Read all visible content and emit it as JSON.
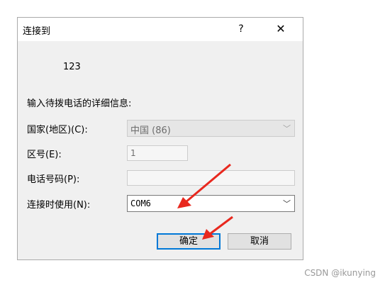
{
  "dialog": {
    "title": "连接到",
    "help_glyph": "?",
    "close_glyph": "✕",
    "connection_name": "123",
    "instruction": "输入待拨电话的详细信息:",
    "country_label": "国家(地区)(C):",
    "country_value": "中国 (86)",
    "area_label": "区号(E):",
    "area_value": "1",
    "phone_label": "电话号码(P):",
    "phone_value": "",
    "connect_label": "连接时使用(N):",
    "connect_value": "COM6",
    "ok_label": "确定",
    "cancel_label": "取消"
  },
  "watermark": "CSDN @ikunying",
  "colors": {
    "annotation_arrow": "#e8281e",
    "focus_border": "#0078d7"
  }
}
